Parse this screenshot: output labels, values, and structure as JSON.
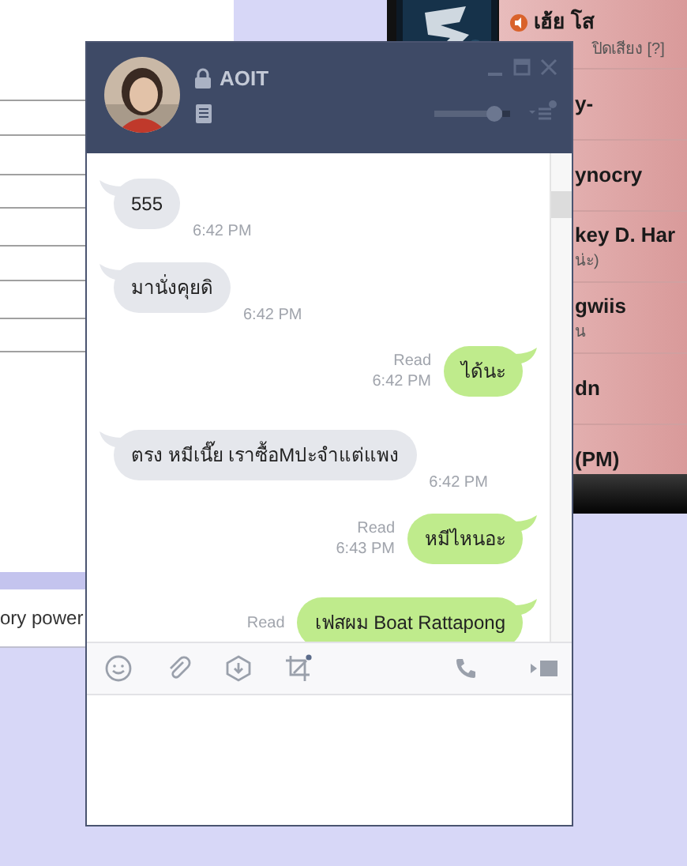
{
  "left_window": {
    "footer_text": "ory power"
  },
  "contact_window": {
    "contacts": [
      {
        "name": "เฮ้ย โส",
        "subtitle": "ปิดเสียง [?]",
        "muted": true
      },
      {
        "name": "y-",
        "muted": false
      },
      {
        "name": "ynocry",
        "muted": false
      },
      {
        "name": "key D. Har",
        "subtitle": "น่ะ)",
        "muted": false
      },
      {
        "name": "gwiis",
        "subtitle": "น",
        "muted": false
      },
      {
        "name": "dn",
        "muted": false
      },
      {
        "name": "(PM)",
        "muted": false
      }
    ]
  },
  "chat_window": {
    "title": "AOIT",
    "volume": {
      "level": 0.9
    },
    "messages": [
      {
        "kind": "incoming",
        "text": "555",
        "time": "6:42 PM"
      },
      {
        "kind": "incoming",
        "text": "มานั่งคุยดิ",
        "time": "6:42 PM"
      },
      {
        "kind": "outgoing",
        "text": "ได้นะ",
        "status": "Read",
        "time": "6:42 PM"
      },
      {
        "kind": "incoming",
        "text": "ตรง หมีเนี๊ย เราซื้อMปะจำแต่แพง",
        "time": "6:42 PM"
      },
      {
        "kind": "outgoing",
        "text": "หมีไหนอะ",
        "status": "Read",
        "time": "6:43 PM"
      },
      {
        "kind": "outgoing",
        "text": "เฟสผม Boat Rattapong",
        "status": "Read"
      }
    ]
  }
}
